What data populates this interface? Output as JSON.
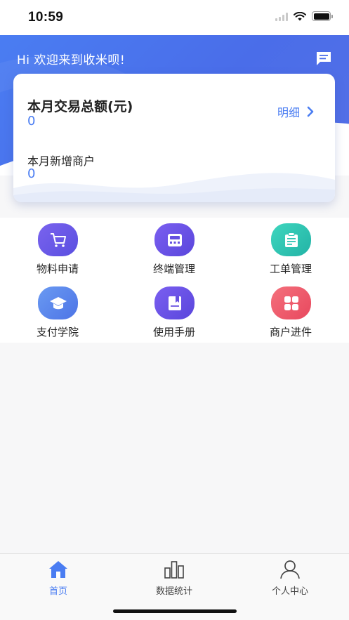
{
  "status_bar": {
    "time": "10:59"
  },
  "header": {
    "greeting": "Hi 欢迎来到收米呗!",
    "message_icon": "message-icon"
  },
  "card": {
    "monthly_total_label": "本月交易总额(元)",
    "monthly_total_value": "0",
    "detail_label": "明细",
    "new_merchants_label": "本月新增商户",
    "new_merchants_value": "0"
  },
  "grid": {
    "items": [
      {
        "label": "物料申请",
        "icon": "cart-icon",
        "color": "#6b5be6"
      },
      {
        "label": "终端管理",
        "icon": "terminal-icon",
        "color": "#6650e0"
      },
      {
        "label": "工单管理",
        "icon": "clipboard-icon",
        "color": "#2fc4b2"
      },
      {
        "label": "支付学院",
        "icon": "graduation-cap-icon",
        "color": "#5d86ec"
      },
      {
        "label": "使用手册",
        "icon": "manual-icon",
        "color": "#6650e0"
      },
      {
        "label": "商户进件",
        "icon": "apps-icon",
        "color": "#ef5a6c"
      }
    ]
  },
  "tabbar": {
    "tabs": [
      {
        "label": "首页",
        "icon": "home-icon",
        "active": true
      },
      {
        "label": "数据统计",
        "icon": "bar-chart-icon",
        "active": false
      },
      {
        "label": "个人中心",
        "icon": "user-icon",
        "active": false
      }
    ]
  },
  "colors": {
    "accent": "#4a7df2",
    "header_bg": "#4a6de9"
  }
}
